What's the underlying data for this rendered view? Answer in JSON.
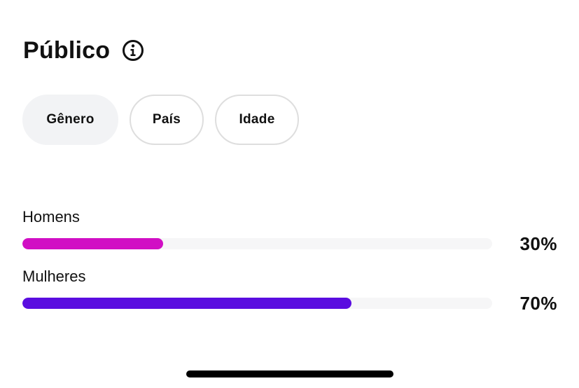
{
  "section": {
    "title": "Público",
    "info_icon": "info-circle-icon"
  },
  "tabs": [
    {
      "label": "Gênero",
      "active": true
    },
    {
      "label": "País",
      "active": false
    },
    {
      "label": "Idade",
      "active": false
    }
  ],
  "audience": [
    {
      "label": "Homens",
      "value_text": "30%",
      "fraction": 0.3,
      "color": "#d10fc4"
    },
    {
      "label": "Mulheres",
      "value_text": "70%",
      "fraction": 0.7,
      "color": "#5a0de0"
    }
  ],
  "colors": {
    "track": "#f6f6f7",
    "active_tab_bg": "#f2f3f5",
    "tab_border": "#dedede"
  }
}
